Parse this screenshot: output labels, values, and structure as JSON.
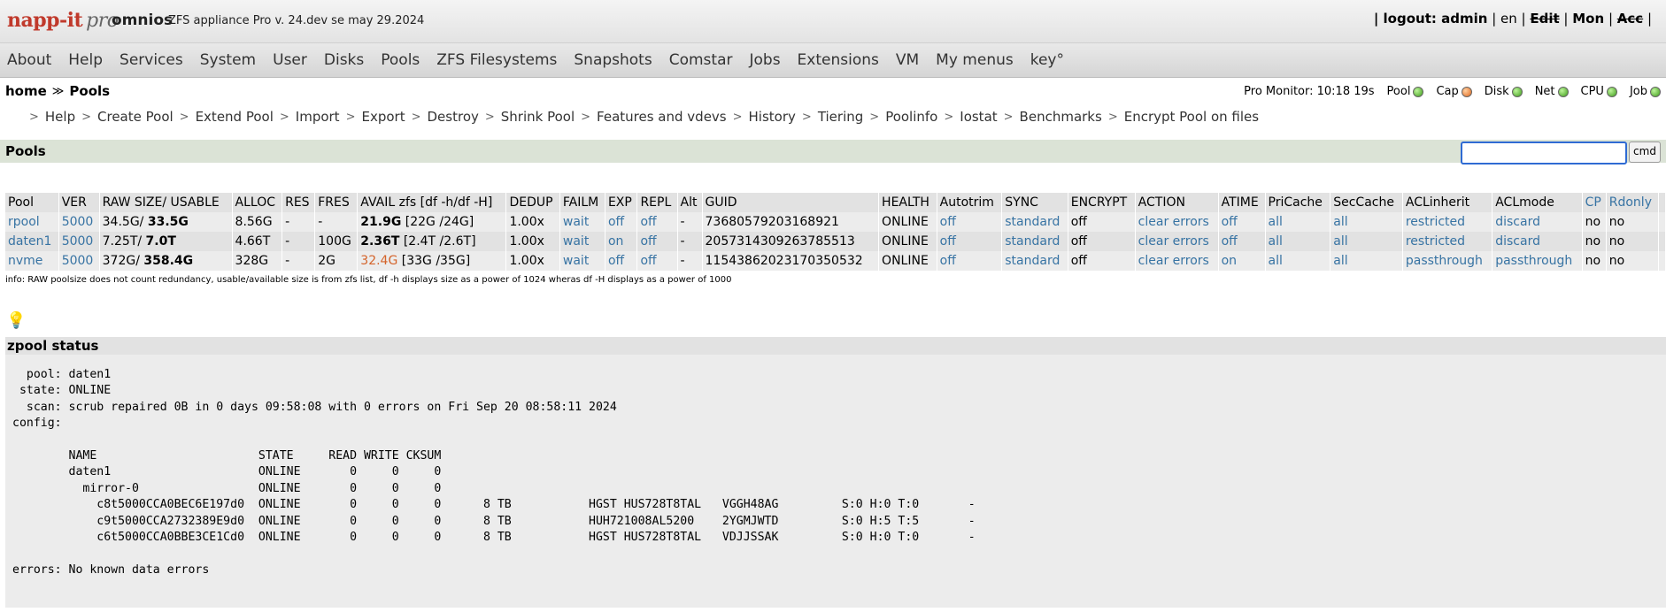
{
  "header": {
    "logo_brand": "napp-it",
    "logo_pro": "pro",
    "host": "omnios",
    "version": "ZFS appliance Pro v. 24.dev se may 29.2024",
    "user_pre": "| logout: admin",
    "user_lang": "en",
    "user_edit": "Edit",
    "user_mon": "Mon",
    "user_acc": "Acc"
  },
  "menu": [
    "About",
    "Help",
    "Services",
    "System",
    "User",
    "Disks",
    "Pools",
    "ZFS Filesystems",
    "Snapshots",
    "Comstar",
    "Jobs",
    "Extensions",
    "VM",
    "My menus",
    "key°"
  ],
  "breadcrumb": {
    "home": "home",
    "arrow": "≫",
    "current": "Pools"
  },
  "monitor": {
    "label": "Pro Monitor: 10:18 19s",
    "items": [
      {
        "name": "Pool",
        "color": "green"
      },
      {
        "name": "Cap",
        "color": "orange"
      },
      {
        "name": "Disk",
        "color": "green"
      },
      {
        "name": "Net",
        "color": "green"
      },
      {
        "name": "CPU",
        "color": "green"
      },
      {
        "name": "Job",
        "color": "green"
      }
    ]
  },
  "submenu": [
    "Help",
    "Create Pool",
    "Extend Pool",
    "Import",
    "Export",
    "Destroy",
    "Shrink Pool",
    "Features and vdevs",
    "History",
    "Tiering",
    "Poolinfo",
    "Iostat",
    "Benchmarks",
    "Encrypt Pool on files"
  ],
  "pools_section": {
    "title": "Pools",
    "cmd_label": "cmd",
    "cmd_value": ""
  },
  "table": {
    "headers": [
      "Pool",
      "VER",
      "RAW SIZE/ USABLE",
      "ALLOC",
      "RES",
      "FRES",
      "AVAIL zfs [df -h/df -H]",
      "DEDUP",
      "FAILM",
      "EXP",
      "REPL",
      "Alt",
      "GUID",
      "HEALTH",
      "Autotrim",
      "SYNC",
      "ENCRYPT",
      "ACTION",
      "ATIME",
      "PriCache",
      "SecCache",
      "ACLinherit",
      "ACLmode",
      "CP",
      "Rdonly"
    ],
    "rows": [
      {
        "pool": "rpool",
        "ver": "5000",
        "raw": "34.5G/",
        "usable": "33.5G",
        "alloc": "8.56G",
        "res": "-",
        "fres": "-",
        "avail_bold": "21.9G",
        "avail_rest": "[22G /24G]",
        "dedup": "1.00x",
        "failm": "wait",
        "exp": "off",
        "repl": "off",
        "alt": "-",
        "guid": "7368057920316892​1",
        "health": "ONLINE",
        "autotrim": "off",
        "sync": "standard",
        "encrypt": "off",
        "action": "clear errors",
        "atime": "off",
        "pricache": "all",
        "seccache": "all",
        "aclinherit": "restricted",
        "aclmode": "discard",
        "cp": "no",
        "rdonly": "no"
      },
      {
        "pool": "daten1",
        "ver": "5000",
        "raw": "7.25T/",
        "usable": "7.0T",
        "alloc": "4.66T",
        "res": "-",
        "fres": "100G",
        "avail_bold": "2.36T",
        "avail_rest": "[2.4T /2.6T]",
        "dedup": "1.00x",
        "failm": "wait",
        "exp": "on",
        "repl": "off",
        "alt": "-",
        "guid": "2057314309263785513",
        "health": "ONLINE",
        "autotrim": "off",
        "sync": "standard",
        "encrypt": "off",
        "action": "clear errors",
        "atime": "off",
        "pricache": "all",
        "seccache": "all",
        "aclinherit": "restricted",
        "aclmode": "discard",
        "cp": "no",
        "rdonly": "no"
      },
      {
        "pool": "nvme",
        "ver": "5000",
        "raw": "372G/",
        "usable": "358.4G",
        "alloc": "328G",
        "res": "-",
        "fres": "2G",
        "avail_bold": "32.4G",
        "avail_rest": "[33G /35G]",
        "dedup": "1.00x",
        "failm": "wait",
        "exp": "off",
        "repl": "off",
        "alt": "-",
        "guid": "11543862023170350532",
        "health": "ONLINE",
        "autotrim": "off",
        "sync": "standard",
        "encrypt": "off",
        "action": "clear errors",
        "atime": "on",
        "pricache": "all",
        "seccache": "all",
        "aclinherit": "passthrough",
        "aclmode": "passthrough",
        "cp": "no",
        "rdonly": "no"
      }
    ]
  },
  "info_text": "info: RAW poolsize does not count redundancy, usable/available size is from zfs list, df -h displays size as a power of 1024 wheras df -H displays as a power of 1000",
  "status_title": "zpool status",
  "status_text": "  pool: daten1\n state: ONLINE\n  scan: scrub repaired 0B in 0 days 09:58:08 with 0 errors on Fri Sep 20 08:58:11 2024\nconfig:\n\n        NAME                       STATE     READ WRITE CKSUM\n        daten1                     ONLINE       0     0     0\n          mirror-0                 ONLINE       0     0     0\n            c8t5000CCA0BEC6E197d0  ONLINE       0     0     0      8 TB           HGST HUS728T8TAL   VGGH48AG         S:0 H:0 T:0       -\n            c9t5000CCA2732389E9d0  ONLINE       0     0     0      8 TB           HUH721008AL5200    2YGMJWTD         S:0 H:5 T:5       -\n            c6t5000CCA0BBE3CE1Cd0  ONLINE       0     0     0      8 TB           HGST HUS728T8TAL   VDJJSSAK         S:0 H:0 T:0       -\n\nerrors: No known data errors",
  "colors": {
    "link": "#3773a3",
    "brand": "#c0392b",
    "warn": "#d4632a",
    "pools_bar": "#dbe3d6"
  },
  "icons": {
    "bulb": "lightbulb-icon"
  }
}
